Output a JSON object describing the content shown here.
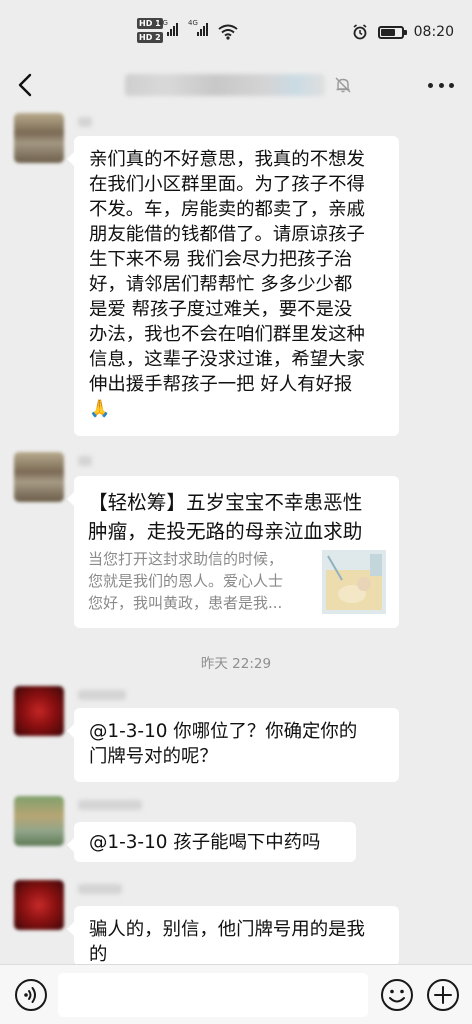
{
  "status_bar": {
    "hd1": "HD 1",
    "hd2": "HD 2",
    "net1": "4G",
    "net2": "4G",
    "time": "08:20",
    "battery_level_percent": 80
  },
  "nav": {
    "title_blurred": true,
    "icons": [
      "back-arrow-icon",
      "mute-bell-icon",
      "more-dots-icon"
    ]
  },
  "messages": {
    "m1": {
      "lines": [
        "亲们真的不好意思，我真的不想发",
        "在我们小区群里面。为了孩子不得",
        "不发。车，房能卖的都卖了，亲戚",
        "朋友能借的钱都借了。请原谅孩子",
        "生下来不易 我们会尽力把孩子治",
        "好，请邻居们帮帮忙 多多少少都",
        "是爱 帮孩子度过难关，要不是没",
        "办法，我也不会在咱们群里发这种",
        "信息，这辈子没求过谁，希望大家",
        "伸出援手帮孩子一把 好人有好报"
      ],
      "emoji": "🙏"
    },
    "card": {
      "title_line1": "【轻松筹】五岁宝宝不幸患恶性",
      "title_line2": "肿瘤，走投无路的母亲泣血求助",
      "desc_line1": "当您打开这封求助信的时候，",
      "desc_line2": "您就是我们的恩人。爱心人士",
      "desc_line3": "您好，我叫黄政，患者是我..."
    },
    "timestamp": "昨天 22:29",
    "m3": {
      "line1": "@1-3-10  你哪位了？你确定你的",
      "line2": "门牌号对的呢？"
    },
    "m4": {
      "line1": "@1-3-10  孩子能喝下中药吗"
    },
    "m5": {
      "line1": "骗人的，别信，他门牌号用的是我",
      "line2": "的"
    }
  },
  "input_bar": {
    "icons": [
      "voice-icon",
      "emoji-icon",
      "plus-icon"
    ]
  }
}
